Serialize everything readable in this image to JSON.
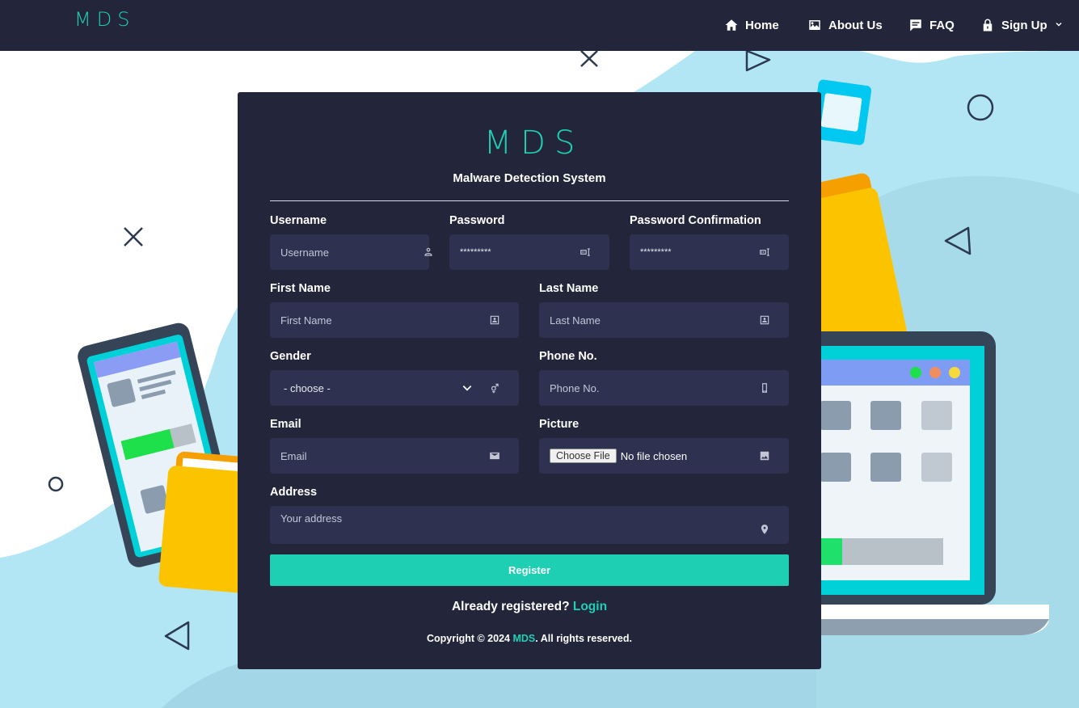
{
  "brand": "MDS",
  "nav": {
    "items": [
      {
        "label": "Home",
        "icon": "home-icon"
      },
      {
        "label": "About Us",
        "icon": "image-icon"
      },
      {
        "label": "FAQ",
        "icon": "message-icon"
      },
      {
        "label": "Sign Up",
        "icon": "lock-icon"
      }
    ]
  },
  "card": {
    "logo": "MDS",
    "subtitle": "Malware Detection System"
  },
  "form": {
    "username": {
      "label": "Username",
      "placeholder": "Username",
      "icon": "user-icon"
    },
    "password": {
      "label": "Password",
      "value": "*********",
      "icon": "password-icon"
    },
    "password_confirm": {
      "label": "Password Confirmation",
      "value": "*********",
      "icon": "password-icon"
    },
    "first_name": {
      "label": "First Name",
      "placeholder": "First Name",
      "icon": "id-card-icon"
    },
    "last_name": {
      "label": "Last Name",
      "placeholder": "Last Name",
      "icon": "id-card-icon"
    },
    "gender": {
      "label": "Gender",
      "value": "- choose -",
      "icon": "gender-icon"
    },
    "phone": {
      "label": "Phone No.",
      "placeholder": "Phone No.",
      "icon": "phone-icon"
    },
    "email": {
      "label": "Email",
      "placeholder": "Email",
      "icon": "mail-icon"
    },
    "picture": {
      "label": "Picture",
      "button": "Choose File",
      "status": "No file chosen",
      "icon": "image-icon"
    },
    "address": {
      "label": "Address",
      "placeholder": "Your address",
      "icon": "location-pin-icon"
    },
    "submit": "Register"
  },
  "footer": {
    "already_text": "Already registered?",
    "login_link": "Login",
    "copyright_prefix": "Copyright © 2024",
    "copyright_brand": "MDS",
    "copyright_suffix": ". All rights reserved."
  },
  "colors": {
    "navbar": "#23263a",
    "card": "#23263a",
    "field": "#2e3250",
    "accent": "#1ecfb4",
    "background_blob": "#b3e6f5"
  }
}
